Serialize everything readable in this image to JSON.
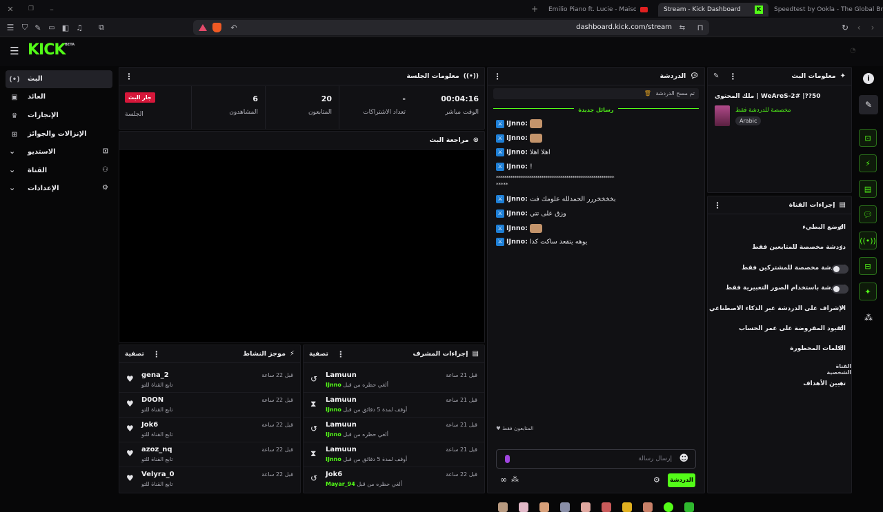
{
  "browser": {
    "tabs": [
      {
        "label": "Emilio Piano ft. Lucie - Maison - YouT"
      },
      {
        "label": "Stream - Kick Dashboard"
      },
      {
        "label": "Speedtest by Ookla - The Global Broa"
      }
    ],
    "url": "dashboard.kick.com/stream"
  },
  "app": {
    "logo": "KICK",
    "logo_tag": "BETA"
  },
  "sidebar": {
    "items": [
      {
        "label": "البث",
        "icon": "live-icon"
      },
      {
        "label": "العائد",
        "icon": "revenue-icon"
      },
      {
        "label": "الإنجازات",
        "icon": "trophy-icon"
      },
      {
        "label": "الإنزالات والجوائز",
        "icon": "gift-icon"
      },
      {
        "label": "الاستديو",
        "icon": "studio-icon"
      },
      {
        "label": "القناة",
        "icon": "channel-icon"
      },
      {
        "label": "الإعدادات",
        "icon": "gear-icon"
      }
    ]
  },
  "session": {
    "title": "معلومات الجلسة",
    "stats": [
      {
        "value": "00:04:16",
        "label": "الوقت مباشر"
      },
      {
        "value": "-",
        "label": "تعداد الاشتراكات"
      },
      {
        "value": "20",
        "label": "المتابعون"
      },
      {
        "value": "6",
        "label": "المشاهدون"
      }
    ],
    "live_badge": "جار البث",
    "session_label": "الجلسة"
  },
  "preview": {
    "title": "مراجعة البث"
  },
  "activity": {
    "title": "موجز النشاط",
    "filter": "تصفية",
    "rows": [
      {
        "name": "gena_2",
        "sub": "تابع القناة للتو",
        "time": "قبل 22 ساعة"
      },
      {
        "name": "D0ON",
        "sub": "تابع القناة للتو",
        "time": "قبل 22 ساعة"
      },
      {
        "name": "Jok6",
        "sub": "تابع القناة للتو",
        "time": "قبل 22 ساعة"
      },
      {
        "name": "azoz_nq",
        "sub": "تابع القناة للتو",
        "time": "قبل 22 ساعة"
      },
      {
        "name": "Velyra_0",
        "sub": "تابع القناة للتو",
        "time": "قبل 22 ساعة"
      }
    ]
  },
  "modactions": {
    "title": "إجراءات المشرف",
    "filter": "تصفية",
    "rows": [
      {
        "name": "Lamuun",
        "action": "ألغي حظره من قبل",
        "mod": "IJnno",
        "time": "قبل 21 ساعة",
        "icon": "undo-icon"
      },
      {
        "name": "Lamuun",
        "action": "أوقف لمدة 5 دقائق من قبل",
        "mod": "IJnno",
        "time": "قبل 21 ساعة",
        "icon": "hourglass-icon"
      },
      {
        "name": "Lamuun",
        "action": "ألغي حظره من قبل",
        "mod": "IJnno",
        "time": "قبل 21 ساعة",
        "icon": "undo-icon"
      },
      {
        "name": "Lamuun",
        "action": "أوقف لمدة 5 دقائق من قبل",
        "mod": "IJnno",
        "time": "قبل 21 ساعة",
        "icon": "hourglass-icon"
      },
      {
        "name": "Jok6",
        "action": "ألغي حظره من قبل",
        "mod": "Mayar_94",
        "time": "قبل 22 ساعة",
        "icon": "undo-icon"
      }
    ]
  },
  "chat": {
    "title": "الدردشة",
    "cleared": "تم مسح الدردشة",
    "new_messages": "رسائل جديدة",
    "messages": [
      {
        "user": "IJnno:",
        "text": ""
      },
      {
        "user": "IJnno:",
        "text": ""
      },
      {
        "user": "IJnno:",
        "text": "اهلا اهلا"
      },
      {
        "user": "IJnno:",
        "text": "!"
      },
      {
        "user": "",
        "text": "*********************************************************"
      },
      {
        "user": "",
        "text": "*****"
      },
      {
        "user": "IJnno:",
        "text": "بخخخخررر الحمدلله علومك فت"
      },
      {
        "user": "IJnno:",
        "text": "وزق على تتي"
      },
      {
        "user": "IJnno:",
        "text": ""
      },
      {
        "user": "IJnno:",
        "text": "يوهه يتقعد ساكت كذا"
      }
    ],
    "followers_only": "المتابعون فقط",
    "input_placeholder": "إرسال رسالة",
    "send": "الدردشة"
  },
  "streaminfo": {
    "title": "معلومات البث",
    "stream_title": "50??| #WeAreS-2 | ملك المحتوى",
    "category": "مخصصة للدردشة فقط",
    "language": "Arabic"
  },
  "channel_actions": {
    "title": "إجراءات القناة",
    "items": [
      {
        "label": "الوضع البطيء",
        "control": "chevron"
      },
      {
        "label": "دردشة مخصصة للمتابعين فقط",
        "control": "chevron"
      },
      {
        "label": "الدردشة مخصصة للمشتركين فقط",
        "control": "toggle"
      },
      {
        "label": "الدردشة باستخدام الصور التعبيرية فقط",
        "control": "toggle"
      },
      {
        "label": "الإشراف على الدردشة عبر الذكاء الاصطناعي",
        "control": "external"
      },
      {
        "label": "القيود المفروضة على عمر الحساب",
        "control": "chevron"
      },
      {
        "label": "الكلمات المحظورة",
        "control": "chevron"
      }
    ],
    "section": "القناة الشخصية",
    "goals": "تعيين الأهداف"
  },
  "colors": {
    "accent": "#53fc18",
    "live": "#d6173a",
    "badge": "#1e7fd6"
  }
}
